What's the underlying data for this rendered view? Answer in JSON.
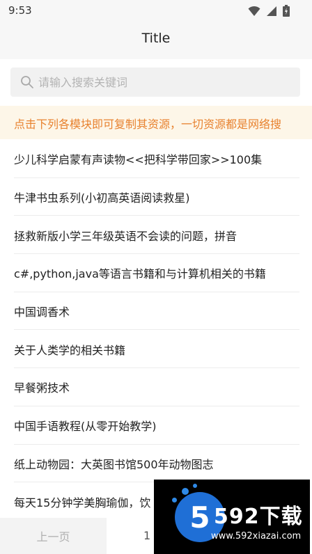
{
  "status_bar": {
    "time": "9:53",
    "icons": [
      "wifi-icon",
      "signal-icon",
      "battery-icon"
    ]
  },
  "nav": {
    "title": "Title"
  },
  "search": {
    "placeholder": "请输入搜索关键词",
    "value": ""
  },
  "notice": {
    "text": "点击下列各模块即可复制其资源，一切资源都是网络搜"
  },
  "list": {
    "items": [
      "少儿科学启蒙有声读物<<把科学带回家>>100集",
      "牛津书虫系列(小初高英语阅读救星)",
      "拯救新版小学三年级英语不会读的问题，拼音",
      "c#,python,java等语言书籍和与计算机相关的书籍",
      "中国调香术",
      "关于人类学的相关书籍",
      "早餐粥技术",
      "中国手语教程(从零开始教学)",
      "纸上动物园：大英图书馆500年动物图志",
      "每天15分钟学美胸瑜伽，饮"
    ]
  },
  "pager": {
    "prev_label": "上一页",
    "page": "1"
  },
  "watermark": {
    "digit": "5",
    "brand": "592下载",
    "url": "www.592xiazai.com"
  },
  "colors": {
    "notice_text": "#e8822f",
    "notice_bg": "#fdf6e8",
    "watermark_blue": "#1f6fd6"
  }
}
